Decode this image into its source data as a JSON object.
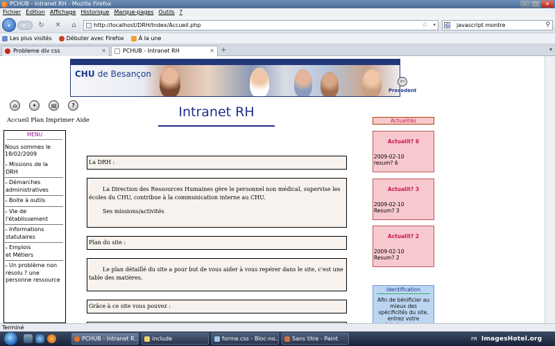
{
  "window": {
    "title": "PCHUB - Intranet RH - Mozilla Firefox"
  },
  "menubar": [
    "Fichier",
    "Édition",
    "Affichage",
    "Historique",
    "Marque-pages",
    "Outils",
    "?"
  ],
  "nav": {
    "url": "http://localhost/DRH/Index/Accueil.php",
    "search": "javascript montre",
    "search_engine": "G"
  },
  "bookmarks": [
    "Les plus visités",
    "Débuter avec Firefox",
    "À la une"
  ],
  "tabs": [
    {
      "label": "Probleme div css",
      "active": false
    },
    {
      "label": "PCHUB - Intranet RH",
      "active": true
    }
  ],
  "tab_new": "+",
  "banner": {
    "chu": "CHU",
    "city": "de Besançon"
  },
  "prec_label": "Precedent",
  "toplinks": "Accueil Plan Imprimer Aide",
  "page_title": "Intranet RH",
  "menu": {
    "header": "MENU",
    "date_line1": "Nous sommes le",
    "date_line2": "18/02/2009",
    "items": [
      {
        "line1": "Missions de la",
        "line2": "DRH"
      },
      {
        "line1": "Démarches",
        "line2": "administratives"
      },
      {
        "line1": "Boite à outils",
        "line2": ""
      },
      {
        "line1": "Vie de",
        "line2": "l'établissement"
      },
      {
        "line1": "Informations",
        "line2": "statutaires"
      },
      {
        "line1": "Emplois",
        "line2": "et Métiers"
      },
      {
        "line1": "Un problème non",
        "line2": "résolu ? une",
        "line3": "personne ressource"
      }
    ]
  },
  "main": {
    "box1": "La DRH :",
    "box2_p1": "La Direction des Ressources Humaines gère le personnel non médical, supervise les écoles du CHU, contribue à la communication interne au CHU.",
    "box2_p2": "Ses missions/activités",
    "box3": "Plan du site :",
    "box4": "Le plan détaillé du site a pour but de vous aider à vous repérer dans le site, c'est une table des matières.",
    "box5": "Grâce à ce site vous pouvez :"
  },
  "news": {
    "header": "Actualités",
    "items": [
      {
        "title": "Actualit? 6",
        "date": "2009-02-10",
        "summary": "resum? 6"
      },
      {
        "title": "Actualit? 3",
        "date": "2009-02-10",
        "summary": "Resum? 3"
      },
      {
        "title": "Actualit? 2",
        "date": "2009-02-10",
        "summary": "Resum? 2"
      }
    ]
  },
  "ident": {
    "header": "Identification",
    "body": "Afin de bénificier au mieux des spécificités du site, entrez votre matricule pour vous"
  },
  "statusbar": "Terminé",
  "taskbar": {
    "items": [
      {
        "label": "PCHUB - Intranet R...",
        "active": true
      },
      {
        "label": "include",
        "active": false
      },
      {
        "label": "forme.css - Bloc-no...",
        "active": false
      },
      {
        "label": "Sans titre - Paint",
        "active": false
      }
    ],
    "lang": "FR",
    "watermark": "ImagesHotel.org"
  },
  "colors": {
    "accent": "#1d2f8a",
    "news_bg": "#f7c9cf",
    "news_title": "#c61a4a",
    "menu_header": "#a0139a",
    "ident_bg": "#bcd6f1"
  }
}
